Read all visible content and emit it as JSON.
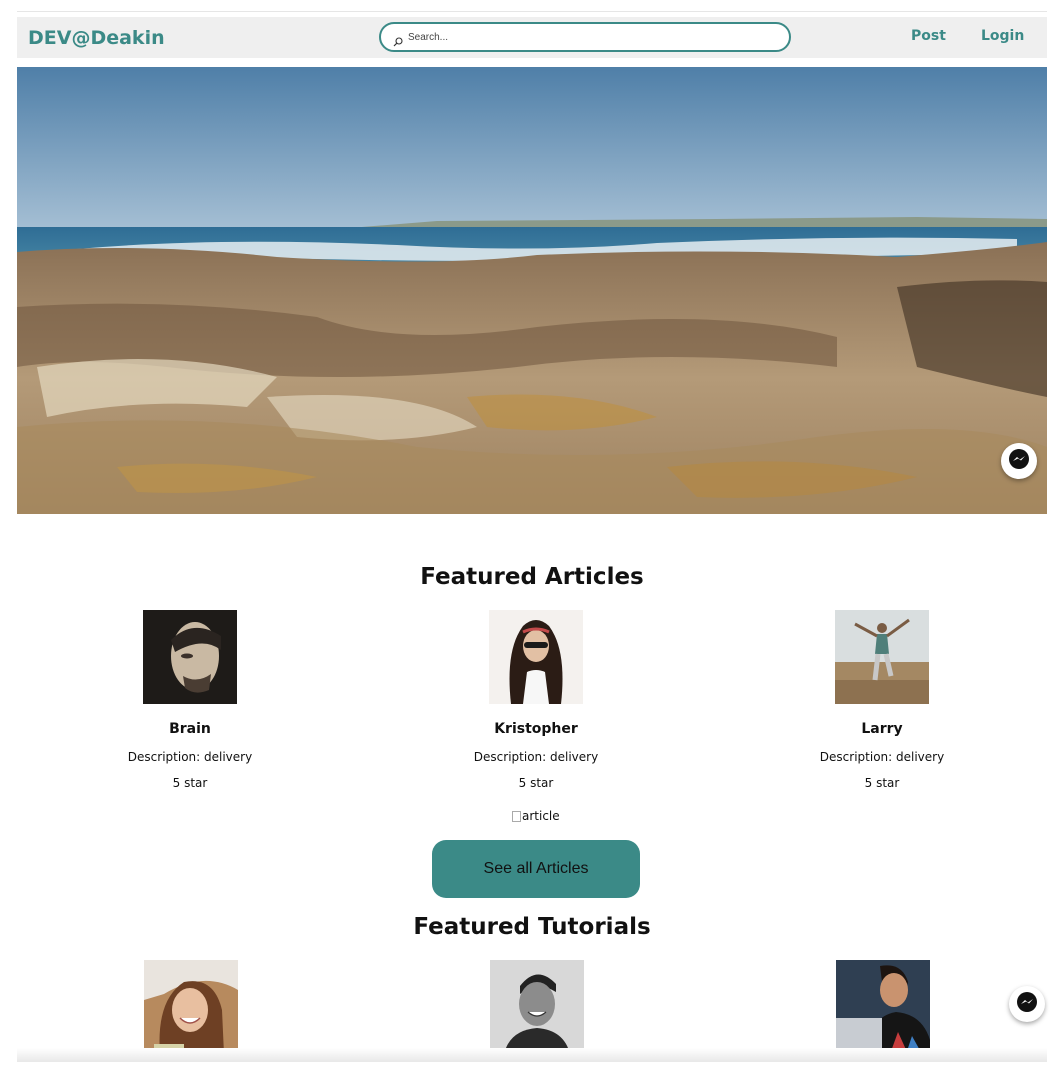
{
  "navbar": {
    "brand": "DEV@Deakin",
    "search_placeholder": "Search...",
    "post_label": "Post",
    "login_label": "Login"
  },
  "featured_articles": {
    "title": "Featured Articles",
    "cards": [
      {
        "name": "Brain",
        "description": "Description: delivery",
        "rating": "5 star"
      },
      {
        "name": "Kristopher",
        "description": "Description: delivery",
        "rating": "5 star"
      },
      {
        "name": "Larry",
        "description": "Description: delivery",
        "rating": "5 star"
      }
    ],
    "broken_image_alt": "article",
    "see_all_label": "See all Articles"
  },
  "featured_tutorials": {
    "title": "Featured Tutorials"
  },
  "icons": {
    "search": "search-icon",
    "messenger": "messenger-icon"
  },
  "colors": {
    "accent": "#3b8a87",
    "navbar_bg": "#efefef"
  }
}
